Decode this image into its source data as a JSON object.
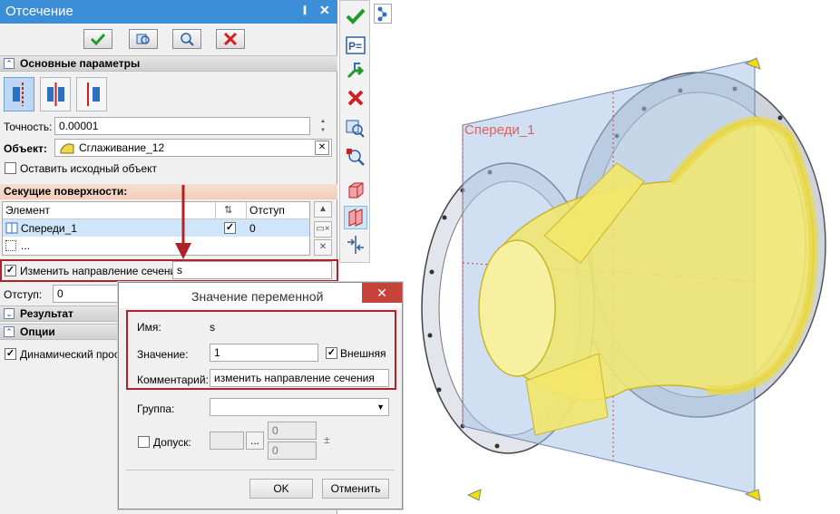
{
  "panel": {
    "title": "Отсечение",
    "pin_glyph": "⊥",
    "close_glyph": "✕",
    "toolbar": {
      "ok_icon": "check-icon",
      "preview_icon": "preview-icon",
      "zoom_icon": "zoom-icon",
      "cancel_icon": "cancel-icon"
    },
    "section_main": "Основные параметры",
    "precision_label": "Точность:",
    "precision_value": "0.00001",
    "object_label": "Объект:",
    "object_value": "Сглаживание_12",
    "keep_source_label": "Оставить исходный объект",
    "keep_source_checked": false,
    "cut_surfaces_header": "Секущие поверхности:",
    "table": {
      "columns": [
        "Элемент",
        "",
        "Отступ"
      ],
      "rows": [
        {
          "element": "Спереди_1",
          "checked": true,
          "offset": "0"
        },
        {
          "element": "...",
          "checked": false,
          "offset": ""
        }
      ]
    },
    "change_dir_label": "Изменить направление сечения:",
    "change_dir_checked": true,
    "change_dir_value": "s",
    "offset_label": "Отступ:",
    "offset_value": "0",
    "section_result": "Результат",
    "section_options": "Опции",
    "dynamic_label": "Динамический просмо",
    "dynamic_checked": true
  },
  "dialog": {
    "title": "Значение переменной",
    "close_glyph": "✕",
    "name_label": "Имя:",
    "name_value": "s",
    "value_label": "Значение:",
    "value_value": "1",
    "external_label": "Внешняя",
    "external_checked": true,
    "comment_label": "Комментарий:",
    "comment_value": "изменить направление сечения",
    "group_label": "Группа:",
    "group_value": "",
    "tolerance_label": "Допуск:",
    "tolerance_checked": false,
    "tol_upper": "0",
    "tol_lower": "0",
    "tol_dots": "...",
    "tol_pm": "±",
    "ok_label": "OK",
    "cancel_label": "Отменить"
  },
  "viewport": {
    "plane_label": "Спереди_1",
    "accent_color": "#e8d84a",
    "plane_color": "#a9c4e6",
    "highlight_color": "#b0212a"
  }
}
